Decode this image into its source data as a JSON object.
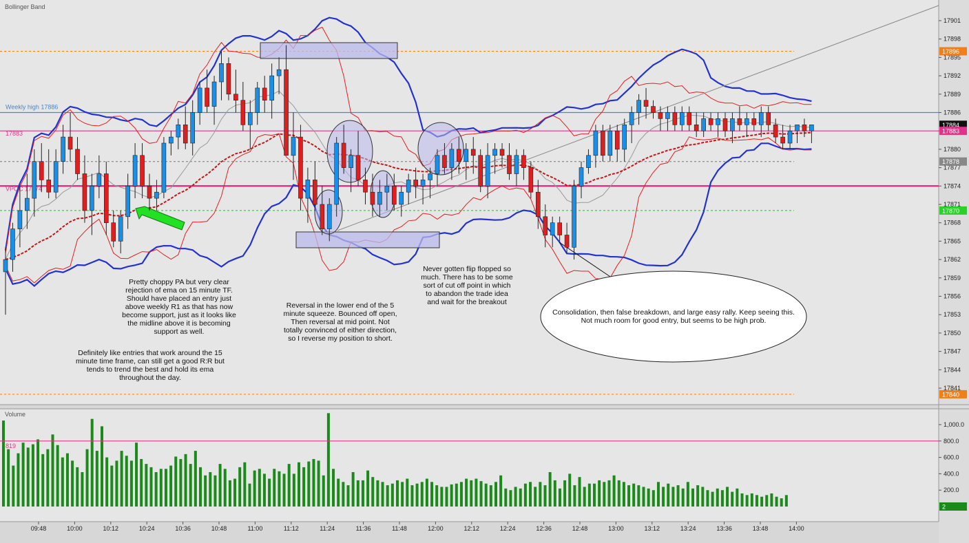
{
  "chart_data": [
    {
      "type": "candlestick",
      "title": "Bollinger Band",
      "x_ticks": [
        "09:48",
        "10:00",
        "10:12",
        "10:24",
        "10:36",
        "10:48",
        "11:00",
        "11:12",
        "11:24",
        "11:36",
        "11:48",
        "12:00",
        "12:12",
        "12:24",
        "12:36",
        "12:48",
        "13:00",
        "13:12",
        "13:24",
        "13:36",
        "13:48",
        "14:00"
      ],
      "y_ticks": [
        17841,
        17844,
        17847,
        17850,
        17853,
        17856,
        17859,
        17862,
        17865,
        17868,
        17871,
        17874,
        17877,
        17880,
        17883,
        17886,
        17889,
        17892,
        17895,
        17898,
        17901
      ],
      "ylim": [
        17840,
        17903
      ],
      "grid": false,
      "candles": [
        [
          17860,
          17864,
          17853,
          17862
        ],
        [
          17862,
          17868,
          17860,
          17867
        ],
        [
          17867,
          17874,
          17864,
          17870
        ],
        [
          17870,
          17876,
          17867,
          17872
        ],
        [
          17872,
          17880,
          17869,
          17878
        ],
        [
          17878,
          17881,
          17873,
          17875
        ],
        [
          17875,
          17880,
          17872,
          17873
        ],
        [
          17873,
          17880,
          17872,
          17878
        ],
        [
          17878,
          17884,
          17876,
          17882
        ],
        [
          17882,
          17886,
          17878,
          17880
        ],
        [
          17880,
          17882,
          17875,
          17876
        ],
        [
          17876,
          17879,
          17868,
          17870
        ],
        [
          17870,
          17876,
          17866,
          17874
        ],
        [
          17874,
          17879,
          17872,
          17876
        ],
        [
          17876,
          17878,
          17866,
          17868
        ],
        [
          17868,
          17870,
          17864,
          17865
        ],
        [
          17865,
          17870,
          17863,
          17869
        ],
        [
          17869,
          17876,
          17867,
          17874
        ],
        [
          17874,
          17881,
          17872,
          17879
        ],
        [
          17879,
          17881,
          17872,
          17874
        ],
        [
          17874,
          17876,
          17870,
          17872
        ],
        [
          17872,
          17875,
          17870,
          17873
        ],
        [
          17873,
          17882,
          17872,
          17881
        ],
        [
          17881,
          17883,
          17879,
          17882
        ],
        [
          17882,
          17885,
          17880,
          17884
        ],
        [
          17884,
          17887,
          17880,
          17881
        ],
        [
          17881,
          17888,
          17879,
          17886
        ],
        [
          17886,
          17891,
          17884,
          17890
        ],
        [
          17890,
          17893,
          17886,
          17887
        ],
        [
          17887,
          17892,
          17884,
          17891
        ],
        [
          17891,
          17896,
          17888,
          17894
        ],
        [
          17894,
          17895,
          17888,
          17889
        ],
        [
          17889,
          17893,
          17886,
          17888
        ],
        [
          17888,
          17891,
          17883,
          17884
        ],
        [
          17884,
          17888,
          17880,
          17886
        ],
        [
          17886,
          17891,
          17884,
          17890
        ],
        [
          17890,
          17892,
          17886,
          17888
        ],
        [
          17888,
          17894,
          17885,
          17892
        ],
        [
          17892,
          17895,
          17889,
          17893
        ],
        [
          17893,
          17897,
          17880,
          17879
        ],
        [
          17879,
          17886,
          17875,
          17882
        ],
        [
          17882,
          17884,
          17870,
          17872
        ],
        [
          17872,
          17877,
          17868,
          17875
        ],
        [
          17875,
          17878,
          17870,
          17871
        ],
        [
          17871,
          17874,
          17866,
          17867
        ],
        [
          17867,
          17872,
          17865,
          17871
        ],
        [
          17871,
          17882,
          17869,
          17881
        ],
        [
          17881,
          17884,
          17876,
          17877
        ],
        [
          17877,
          17880,
          17873,
          17879
        ],
        [
          17879,
          17883,
          17874,
          17875
        ],
        [
          17875,
          17877,
          17871,
          17873
        ],
        [
          17873,
          17876,
          17869,
          17871
        ],
        [
          17871,
          17875,
          17869,
          17873
        ],
        [
          17873,
          17876,
          17870,
          17874
        ],
        [
          17874,
          17876,
          17870,
          17871
        ],
        [
          17871,
          17874,
          17869,
          17873
        ],
        [
          17873,
          17876,
          17871,
          17875
        ],
        [
          17875,
          17877,
          17872,
          17874
        ],
        [
          17874,
          17876,
          17871,
          17875
        ],
        [
          17875,
          17877,
          17872,
          17876
        ],
        [
          17876,
          17880,
          17874,
          17879
        ],
        [
          17879,
          17881,
          17876,
          17877
        ],
        [
          17877,
          17881,
          17875,
          17880
        ],
        [
          17880,
          17882,
          17876,
          17878
        ],
        [
          17878,
          17881,
          17875,
          17880
        ],
        [
          17880,
          17882,
          17876,
          17879
        ],
        [
          17879,
          17880,
          17873,
          17874
        ],
        [
          17874,
          17881,
          17872,
          17879
        ],
        [
          17879,
          17881,
          17876,
          17880
        ],
        [
          17880,
          17881,
          17877,
          17879
        ],
        [
          17879,
          17881,
          17875,
          17876
        ],
        [
          17876,
          17880,
          17874,
          17879
        ],
        [
          17879,
          17880,
          17875,
          17877
        ],
        [
          17877,
          17878,
          17872,
          17873
        ],
        [
          17873,
          17875,
          17867,
          17869
        ],
        [
          17869,
          17871,
          17864,
          17866
        ],
        [
          17866,
          17869,
          17864,
          17868
        ],
        [
          17868,
          17869,
          17865,
          17866
        ],
        [
          17866,
          17868,
          17863,
          17864
        ],
        [
          17864,
          17875,
          17862,
          17874
        ],
        [
          17874,
          17878,
          17872,
          17877
        ],
        [
          17877,
          17880,
          17876,
          17879
        ],
        [
          17879,
          17884,
          17877,
          17883
        ],
        [
          17883,
          17884,
          17878,
          17879
        ],
        [
          17879,
          17884,
          17878,
          17883
        ],
        [
          17883,
          17884,
          17878,
          17880
        ],
        [
          17880,
          17885,
          17878,
          17884
        ],
        [
          17884,
          17887,
          17881,
          17886
        ],
        [
          17886,
          17889,
          17884,
          17888
        ],
        [
          17888,
          17890,
          17885,
          17887
        ],
        [
          17887,
          17888,
          17885,
          17886
        ],
        [
          17886,
          17887,
          17883,
          17885
        ],
        [
          17885,
          17887,
          17883,
          17886
        ],
        [
          17886,
          17887,
          17883,
          17884
        ],
        [
          17884,
          17887,
          17883,
          17886
        ],
        [
          17886,
          17887,
          17883,
          17884
        ],
        [
          17884,
          17886,
          17882,
          17883
        ],
        [
          17883,
          17886,
          17882,
          17885
        ],
        [
          17885,
          17886,
          17883,
          17884
        ],
        [
          17884,
          17886,
          17882,
          17885
        ],
        [
          17885,
          17886,
          17882,
          17883
        ],
        [
          17883,
          17886,
          17881,
          17885
        ],
        [
          17885,
          17887,
          17883,
          17884
        ],
        [
          17884,
          17886,
          17882,
          17885
        ],
        [
          17885,
          17886,
          17883,
          17884
        ],
        [
          17884,
          17887,
          17882,
          17886
        ],
        [
          17886,
          17887,
          17883,
          17884
        ],
        [
          17884,
          17885,
          17881,
          17882
        ],
        [
          17882,
          17884,
          17880,
          17881
        ],
        [
          17881,
          17884,
          17880,
          17883
        ],
        [
          17883,
          17884,
          17881,
          17884
        ],
        [
          17884,
          17885,
          17882,
          17883
        ],
        [
          17883,
          17884,
          17881,
          17884
        ]
      ],
      "horizontal_lines": [
        {
          "label": "Weekly high 17886",
          "value": 17886,
          "color": "#4a86c8",
          "style": "solid"
        },
        {
          "label": "17883",
          "value": 17883,
          "color": "#e0338a",
          "style": "solid"
        },
        {
          "label": "VPOC 17874",
          "value": 17874,
          "color": "#e0338a",
          "style": "thick"
        },
        {
          "value": 17896,
          "color": "#f07f1a",
          "style": "dashed"
        },
        {
          "value": 17840,
          "color": "#f07f1a",
          "style": "dashed"
        },
        {
          "value": 17878,
          "color": "#777777",
          "style": "dashed"
        },
        {
          "value": 17870,
          "color": "#2db83d",
          "style": "dashed"
        }
      ],
      "price_tags": [
        {
          "text": "17896",
          "value": 17896,
          "color": "#f07f1a"
        },
        {
          "text": "17884",
          "value": 17884,
          "color": "#111111"
        },
        {
          "text": "17883",
          "value": 17883,
          "color": "#e0338a"
        },
        {
          "text": "17878",
          "value": 17878,
          "color": "#888888"
        },
        {
          "text": "17870",
          "value": 17870,
          "color": "#29d129"
        },
        {
          "text": "17840",
          "value": 17840,
          "color": "#f07f1a"
        }
      ],
      "annotations": [
        {
          "lines": [
            "Pretty choppy PA but very clear",
            "rejection of ema on 15 minute TF.",
            "Should have placed an entry just",
            "above weekly R1 as that has now",
            "become support, just as it looks like",
            "the midline above it is becoming",
            "support as well."
          ]
        },
        {
          "lines": [
            "Definitely like entries that work around the 15",
            "minute time frame, can still get a good R:R but",
            "tends to trend the best and hold its ema",
            "throughout the day."
          ]
        },
        {
          "lines": [
            "Reversal in the lower end of the 5",
            "minute squeeze.  Bounced off open,",
            "Then reversal at mid point.  Not",
            "totally convinced of either direction,",
            "so I reverse my position to short."
          ]
        },
        {
          "lines": [
            "Never gotten flip flopped so",
            "much.  There has to be some",
            "sort of cut off point in which",
            "to abandon the trade idea",
            "and wait for the breakout"
          ]
        },
        {
          "lines": [
            "Consolidation, then false breakdown, and large easy rally.  Keep seeing this.",
            "Not much room for good entry, but seems to be high prob."
          ]
        }
      ]
    },
    {
      "type": "bar",
      "title": "Volume",
      "y_ticks": [
        "200.0",
        "400.0",
        "600.0",
        "800.0",
        "1,000.0"
      ],
      "ylim": [
        0,
        1100
      ],
      "threshold": {
        "label": "819",
        "value": 800
      },
      "last_value_tag": "2",
      "values": [
        1050,
        700,
        500,
        650,
        780,
        720,
        760,
        820,
        640,
        700,
        880,
        750,
        600,
        650,
        560,
        480,
        420,
        700,
        1070,
        680,
        980,
        600,
        500,
        560,
        680,
        620,
        560,
        780,
        580,
        520,
        480,
        420,
        460,
        460,
        500,
        610,
        580,
        640,
        520,
        680,
        480,
        380,
        420,
        380,
        520,
        460,
        320,
        340,
        480,
        540,
        280,
        440,
        460,
        400,
        340,
        460,
        430,
        400,
        520,
        400,
        540,
        480,
        550,
        580,
        560,
        380,
        1140,
        460,
        340,
        300,
        260,
        420,
        320,
        320,
        440,
        360,
        320,
        300,
        260,
        280,
        320,
        300,
        340,
        260,
        280,
        300,
        340,
        300,
        260,
        240,
        240,
        270,
        280,
        300,
        340,
        320,
        340,
        310,
        280,
        260,
        300,
        380,
        220,
        200,
        240,
        220,
        280,
        300,
        240,
        300,
        260,
        420,
        320,
        220,
        320,
        400,
        260,
        360,
        240,
        280,
        280,
        320,
        300,
        320,
        380,
        320,
        300,
        260,
        280,
        260,
        240,
        220,
        200,
        300,
        240,
        280,
        240,
        260,
        220,
        300,
        220,
        260,
        240,
        200,
        180,
        220,
        200,
        240,
        180,
        220,
        160,
        140,
        160,
        140,
        120,
        140,
        160,
        120,
        100,
        140
      ]
    }
  ]
}
